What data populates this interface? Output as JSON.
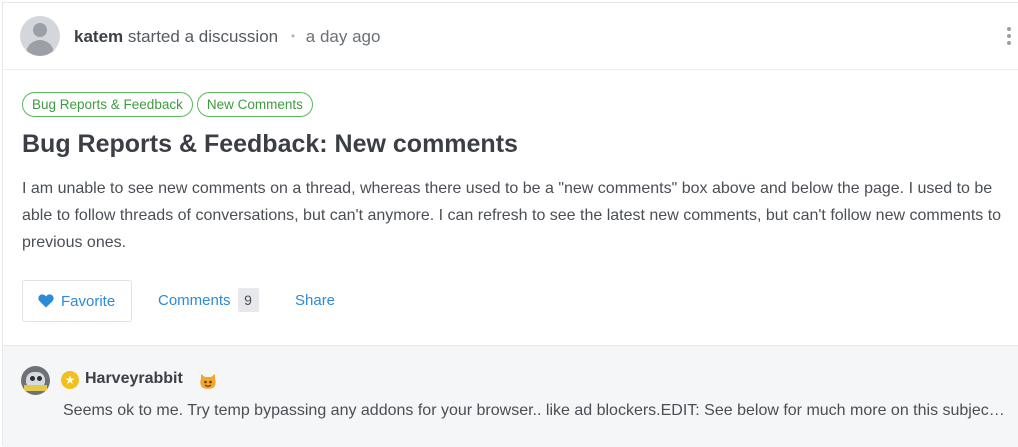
{
  "discussion": {
    "author": "katem",
    "action": "started a discussion",
    "separator": "•",
    "time": "a day ago",
    "tags": [
      "Bug Reports & Feedback",
      "New Comments"
    ],
    "title": "Bug Reports & Feedback: New comments",
    "body": "I am unable to see new comments on a thread, whereas there used to be a \"new comments\" box above and below the page. I used to be able to follow threads of conversations, but can't anymore. I can refresh to see the latest new comments, but can't follow new comments to previous ones.",
    "actions": {
      "favorite_label": "Favorite",
      "comments_label": "Comments",
      "comments_count": "9",
      "share_label": "Share"
    }
  },
  "reply": {
    "author": "Harveyrabbit",
    "text": "Seems ok to me. Try temp bypassing any addons for your browser.. like ad blockers.EDIT: See below for much more on this subject (if you are interested)"
  },
  "colors": {
    "accent": "#2d8ad8",
    "tag_border": "#5cb85c",
    "badge": "#f2c01a"
  },
  "icons": [
    "user-avatar-icon",
    "kebab-menu-icon",
    "heart-icon",
    "star-badge-icon",
    "cat-emoji-icon"
  ]
}
